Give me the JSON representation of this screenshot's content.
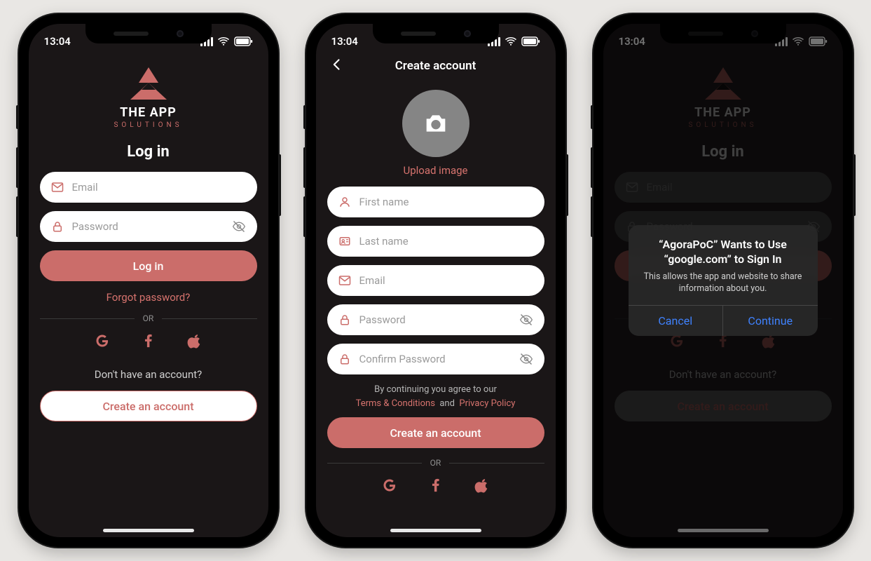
{
  "status": {
    "time": "13:04"
  },
  "brand": {
    "name": "THE APP",
    "tagline": "SOLUTIONS"
  },
  "login": {
    "title": "Log in",
    "email_ph": "Email",
    "password_ph": "Password",
    "submit": "Log in",
    "forgot": "Forgot password?",
    "or": "OR",
    "no_account": "Don't have an account?",
    "create": "Create an account"
  },
  "signup": {
    "header": "Create account",
    "upload": "Upload image",
    "first_ph": "First name",
    "last_ph": "Last name",
    "email_ph": "Email",
    "password_ph": "Password",
    "confirm_ph": "Confirm Password",
    "terms_pre": "By continuing you agree to our",
    "terms_link": "Terms & Conditions",
    "terms_and": "and",
    "privacy_link": "Privacy Policy",
    "submit": "Create an account",
    "or": "OR"
  },
  "alert": {
    "title": "“AgoraPoC” Wants to Use “google.com” to Sign In",
    "message": "This allows the app and website to share information about you.",
    "cancel": "Cancel",
    "continue": "Continue"
  }
}
